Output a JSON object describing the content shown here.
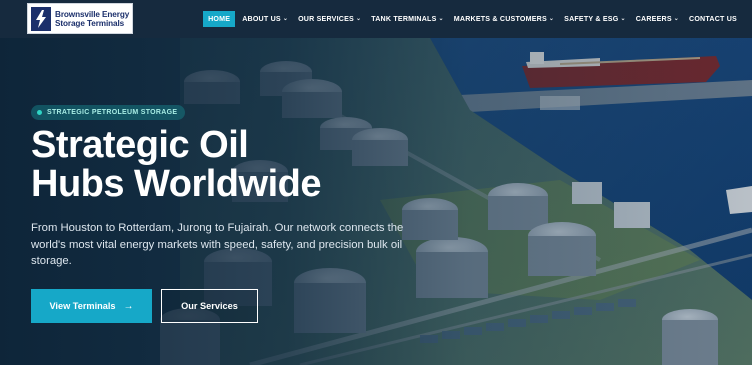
{
  "brand": {
    "name_line1": "Brownsville Energy",
    "name_line2": "Storage Terminals",
    "logo_icon": "lightning-bolt-icon"
  },
  "nav": {
    "items": [
      {
        "label": "HOME",
        "active": true,
        "dropdown": false
      },
      {
        "label": "ABOUT US",
        "active": false,
        "dropdown": true
      },
      {
        "label": "OUR SERVICES",
        "active": false,
        "dropdown": true
      },
      {
        "label": "TANK TERMINALS",
        "active": false,
        "dropdown": true
      },
      {
        "label": "MARKETS & CUSTOMERS",
        "active": false,
        "dropdown": true
      },
      {
        "label": "SAFETY & ESG",
        "active": false,
        "dropdown": true
      },
      {
        "label": "CAREERS",
        "active": false,
        "dropdown": true
      },
      {
        "label": "CONTACT US",
        "active": false,
        "dropdown": false
      }
    ],
    "chevron_glyph": "⌄"
  },
  "hero": {
    "badge": "STRATEGIC PETROLEUM STORAGE",
    "title_line1": "Strategic Oil",
    "title_line2": "Hubs Worldwide",
    "description": "From Houston to Rotterdam, Jurong to Fujairah. Our network connects the world's most vital energy markets with speed, safety, and precision bulk oil storage.",
    "primary_button": "View Terminals",
    "primary_arrow": "→",
    "secondary_button": "Our Services"
  },
  "colors": {
    "accent": "#16a8c8",
    "header_bg": "#162a3e",
    "logo_navy": "#1b2f6b",
    "badge_dot": "#2fd4c4"
  }
}
